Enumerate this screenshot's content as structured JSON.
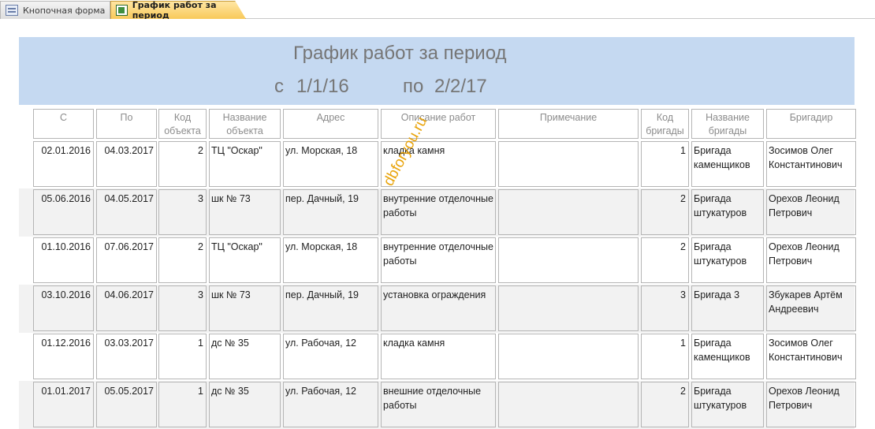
{
  "tabs": [
    {
      "label": "Кнопочная форма",
      "icon": "form-icon",
      "active": false
    },
    {
      "label": "График работ за период",
      "icon": "report-icon",
      "active": true
    }
  ],
  "report": {
    "title": "График работ за период",
    "from_label": "с",
    "from_value": "1/1/16",
    "to_label": "по",
    "to_value": "2/2/17",
    "header_color": "#c5d9f1"
  },
  "columns": [
    {
      "label": "С"
    },
    {
      "label": "По"
    },
    {
      "label": "Код\nобъекта"
    },
    {
      "label": "Название\nобъекта"
    },
    {
      "label": "Адрес"
    },
    {
      "label": "Описание работ"
    },
    {
      "label": "Примечание"
    },
    {
      "label": "Код\nбригады"
    },
    {
      "label": "Название\nбригады"
    },
    {
      "label": "Бригадир"
    }
  ],
  "rows": [
    {
      "start": "02.01.2016",
      "end": "04.03.2017",
      "object_code": "2",
      "object_name": "ТЦ \"Оскар\"",
      "address": "ул. Морская, 18",
      "description": "кладка камня",
      "note": "",
      "brigade_code": "1",
      "brigade_name": "Бригада каменщиков",
      "foreman": "Зосимов Олег Константинович"
    },
    {
      "start": "05.06.2016",
      "end": "04.05.2017",
      "object_code": "3",
      "object_name": "шк № 73",
      "address": "пер. Дачный, 19",
      "description": "внутренние отделочные работы",
      "note": "",
      "brigade_code": "2",
      "brigade_name": "Бригада штукатуров",
      "foreman": "Орехов Леонид Петрович"
    },
    {
      "start": "01.10.2016",
      "end": "07.06.2017",
      "object_code": "2",
      "object_name": "ТЦ \"Оскар\"",
      "address": "ул. Морская, 18",
      "description": "внутренние отделочные работы",
      "note": "",
      "brigade_code": "2",
      "brigade_name": "Бригада штукатуров",
      "foreman": "Орехов Леонид Петрович"
    },
    {
      "start": "03.10.2016",
      "end": "04.06.2017",
      "object_code": "3",
      "object_name": "шк № 73",
      "address": "пер. Дачный, 19",
      "description": "установка ограждения",
      "note": "",
      "brigade_code": "3",
      "brigade_name": "Бригада 3",
      "foreman": "Збукарев Артём Андреевич"
    },
    {
      "start": "01.12.2016",
      "end": "03.03.2017",
      "object_code": "1",
      "object_name": "дс № 35",
      "address": "ул. Рабочая, 12",
      "description": "кладка камня",
      "note": "",
      "brigade_code": "1",
      "brigade_name": "Бригада каменщиков",
      "foreman": "Зосимов Олег Константинович"
    },
    {
      "start": "01.01.2017",
      "end": "05.05.2017",
      "object_code": "1",
      "object_name": "дс № 35",
      "address": "ул. Рабочая, 12",
      "description": "внешние отделочные работы",
      "note": "",
      "brigade_code": "2",
      "brigade_name": "Бригада штукатуров",
      "foreman": "Орехов Леонид Петрович"
    }
  ],
  "watermark": "dbforyou.ru"
}
